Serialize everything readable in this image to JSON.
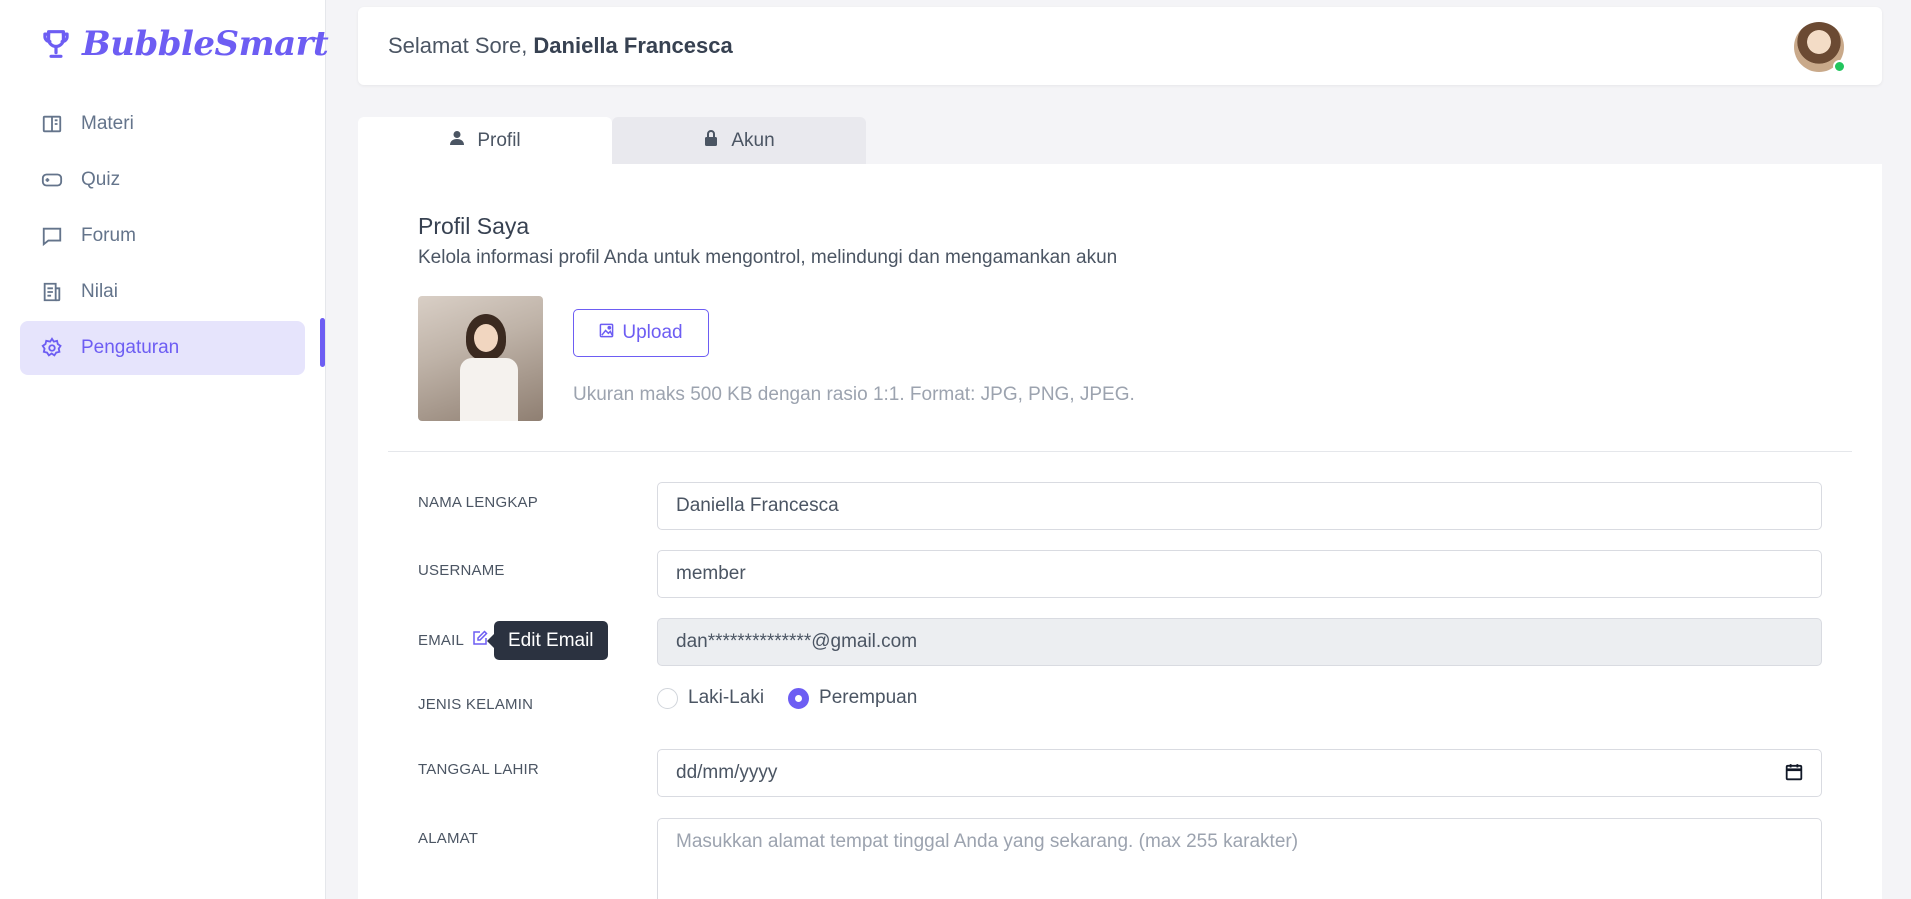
{
  "brand": {
    "name": "BubbleSmart",
    "color": "#6d5df3",
    "icon": "trophy-icon"
  },
  "sidebar": {
    "items": [
      {
        "label": "Materi",
        "icon": "book-open-icon",
        "active": false
      },
      {
        "label": "Quiz",
        "icon": "gamepad-icon",
        "active": false
      },
      {
        "label": "Forum",
        "icon": "chat-icon",
        "active": false
      },
      {
        "label": "Nilai",
        "icon": "report-icon",
        "active": false
      },
      {
        "label": "Pengaturan",
        "icon": "gear-icon",
        "active": true
      }
    ]
  },
  "header": {
    "greeting": "Selamat Sore,",
    "user_name": "Daniella Francesca",
    "online_status_color": "#22c55e"
  },
  "tabs": [
    {
      "label": "Profil",
      "icon": "user-icon",
      "active": true
    },
    {
      "label": "Akun",
      "icon": "lock-icon",
      "active": false
    }
  ],
  "profile": {
    "title": "Profil Saya",
    "description": "Kelola informasi profil Anda untuk mengontrol, melindungi dan mengamankan akun",
    "upload_label": "Upload",
    "upload_hint": "Ukuran maks 500 KB dengan rasio 1:1. Format: JPG, PNG, JPEG."
  },
  "form": {
    "full_name": {
      "label": "NAMA LENGKAP",
      "value": "Daniella Francesca"
    },
    "username": {
      "label": "USERNAME",
      "value": "member"
    },
    "email": {
      "label": "EMAIL",
      "value": "dan**************@gmail.com",
      "tooltip": "Edit Email"
    },
    "gender": {
      "label": "JENIS KELAMIN",
      "options": [
        "Laki-Laki",
        "Perempuan"
      ],
      "selected": "Perempuan"
    },
    "birthdate": {
      "label": "TANGGAL LAHIR",
      "value": "dd/mm/yyyy"
    },
    "address": {
      "label": "ALAMAT",
      "placeholder": "Masukkan alamat tempat tinggal Anda yang sekarang. (max 255 karakter)"
    }
  }
}
